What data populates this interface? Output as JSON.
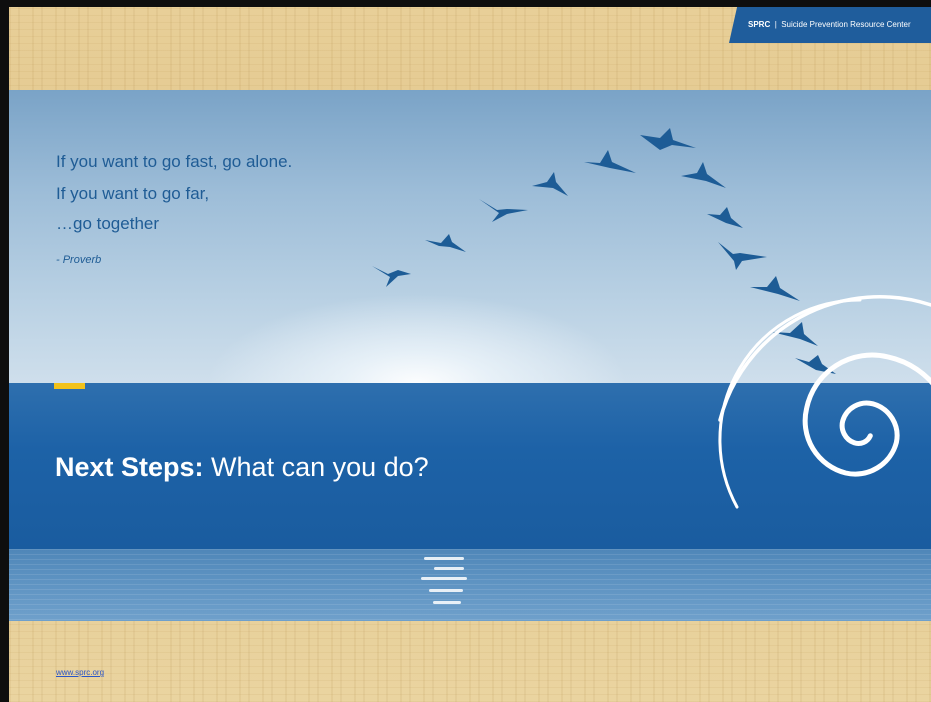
{
  "header": {
    "brand": "SPRC",
    "separator": "|",
    "org_name": "Suicide Prevention Resource Center",
    "bar_color": "#1f5d9c"
  },
  "quote": {
    "line1": "If you want to go fast, go alone.",
    "line2": "If you want to go far,",
    "line3": "…go together",
    "attribution": "- Proverb",
    "text_color": "#1f5c95"
  },
  "title": {
    "bold": "Next Steps:",
    "rest": " What can you do?",
    "accent_color": "#f2c21a"
  },
  "footer": {
    "url": "www.sprc.org"
  },
  "imagery": {
    "birds": "flock-of-geese-in-v-formation",
    "spiral": "white-spiral-logo",
    "background": "sky-over-ocean-with-sunset-glow"
  }
}
